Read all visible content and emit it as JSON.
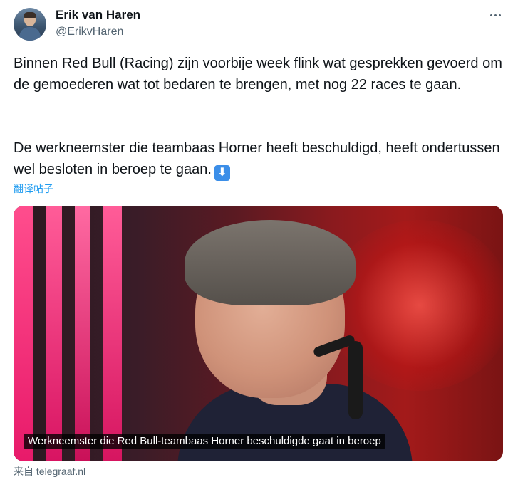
{
  "tweet": {
    "author_name": "Erik van Haren",
    "author_handle": "@ErikvHaren",
    "more_icon": "more-horizontal-icon",
    "paragraph_1": "Binnen Red Bull (Racing) zijn voorbije week flink wat gesprekken gevoerd om de gemoederen wat tot bedaren te brengen, met nog 22 races te gaan.",
    "paragraph_2": "De werkneemster die teambaas Horner heeft beschuldigd, heeft ondertussen wel besloten in beroep te gaan.",
    "emoji": "⬇",
    "emoji_icon": "down-arrow-emoji-icon",
    "translate_label": "翻译帖子"
  },
  "card": {
    "caption": "Werkneemster die Red Bull-teambaas Horner beschuldigde gaat in beroep",
    "source_prefix": "来自",
    "source_domain": "telegraaf.nl"
  },
  "colors": {
    "link": "#1d9bf0",
    "secondary_text": "#536471",
    "primary_text": "#0f1419"
  }
}
